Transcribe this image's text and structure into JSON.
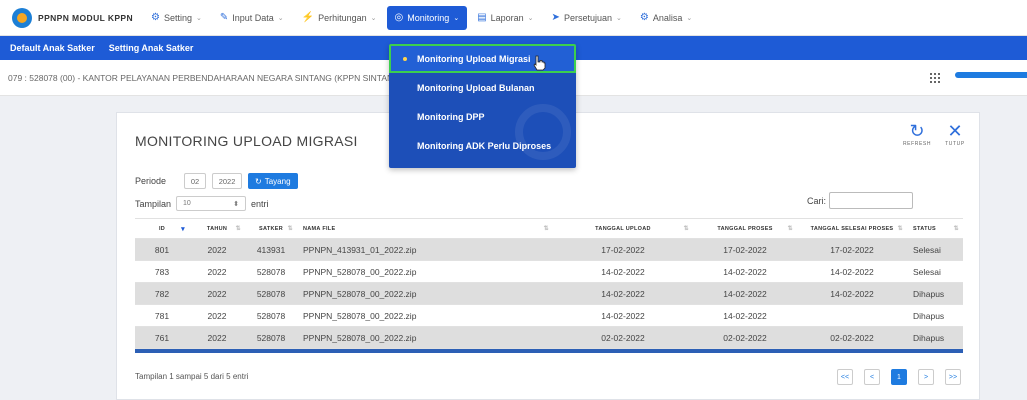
{
  "brand": {
    "name": "PPNPN MODUL KPPN"
  },
  "menu": [
    {
      "label": "Setting",
      "icon": "⚙",
      "active": false
    },
    {
      "label": "Input Data",
      "icon": "✎",
      "active": false
    },
    {
      "label": "Perhitungan",
      "icon": "⚡",
      "active": false
    },
    {
      "label": "Monitoring",
      "icon": "◎",
      "active": true
    },
    {
      "label": "Laporan",
      "icon": "▤",
      "active": false
    },
    {
      "label": "Persetujuan",
      "icon": "➤",
      "active": false
    },
    {
      "label": "Analisa",
      "icon": "⚙",
      "active": false
    }
  ],
  "subnav": [
    "Default Anak Satker",
    "Setting Anak Satker"
  ],
  "infobar": {
    "text": "079 : 528078 (00) - KANTOR PELAYANAN PERBENDAHARAAN NEGARA SINTANG (KPPN SINTANG)"
  },
  "dropdown": [
    "Monitoring Upload Migrasi",
    "Monitoring Upload Bulanan",
    "Monitoring DPP",
    "Monitoring ADK Perlu Diproses"
  ],
  "card": {
    "title": "MONITORING UPLOAD MIGRASI",
    "refresh_label": "REFRESH",
    "close_label": "TUTUP",
    "periode_label": "Periode",
    "periode_month": "02",
    "periode_year": "2022",
    "tayang_label": "Tayang",
    "tampilan_label": "Tampilan",
    "tampilan_value": "10",
    "entri_label": "entri",
    "cari_label": "Cari:",
    "footer": "Tampilan 1 sampai 5 dari 5 entri"
  },
  "table": {
    "headers": [
      "ID",
      "TAHUN",
      "SATKER",
      "NAMA FILE",
      "TANGGAL UPLOAD",
      "TANGGAL PROSES",
      "TANGGAL SELESAI PROSES",
      "STATUS"
    ],
    "rows": [
      [
        "801",
        "2022",
        "413931",
        "PPNPN_413931_01_2022.zip",
        "17-02-2022",
        "17-02-2022",
        "17-02-2022",
        "Selesai"
      ],
      [
        "783",
        "2022",
        "528078",
        "PPNPN_528078_00_2022.zip",
        "14-02-2022",
        "14-02-2022",
        "14-02-2022",
        "Selesai"
      ],
      [
        "782",
        "2022",
        "528078",
        "PPNPN_528078_00_2022.zip",
        "14-02-2022",
        "14-02-2022",
        "14-02-2022",
        "Dihapus"
      ],
      [
        "781",
        "2022",
        "528078",
        "PPNPN_528078_00_2022.zip",
        "14-02-2022",
        "14-02-2022",
        "",
        "Dihapus"
      ],
      [
        "761",
        "2022",
        "528078",
        "PPNPN_528078_00_2022.zip",
        "02-02-2022",
        "02-02-2022",
        "02-02-2022",
        "Dihapus"
      ]
    ]
  },
  "pager": [
    "<<",
    "<",
    "1",
    ">",
    ">>"
  ],
  "colors": {
    "primary": "#1e5bd6",
    "accent": "#1e7be0",
    "highlight": "#3ccf4e"
  }
}
